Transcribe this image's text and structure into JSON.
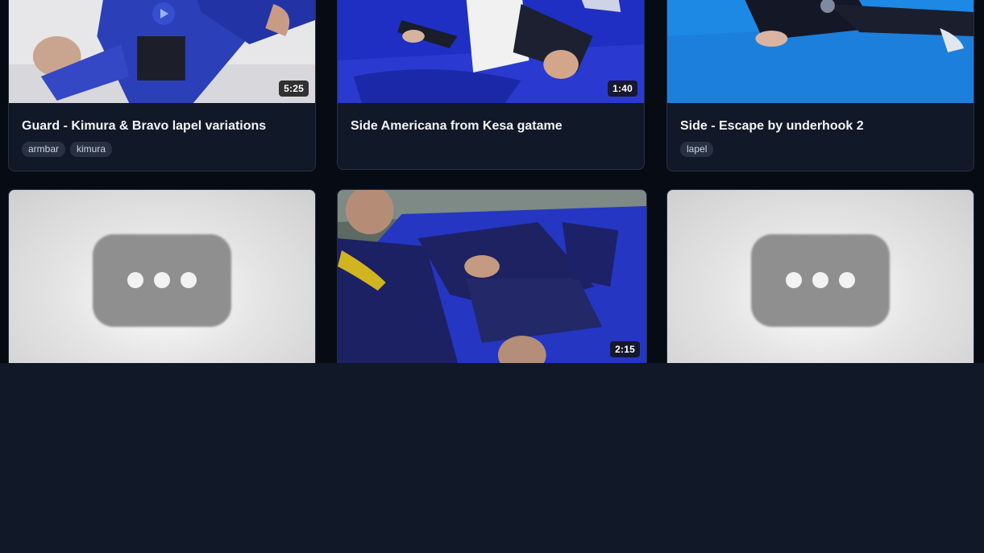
{
  "cards": [
    {
      "title": "Guard - Kimura & Bravo lapel variations",
      "duration": "5:25",
      "tags": [
        "armbar",
        "kimura"
      ]
    },
    {
      "title": "Side Americana from Kesa gatame",
      "duration": "1:40",
      "tags": []
    },
    {
      "title": "Side - Escape by underhook 2",
      "duration": "",
      "tags": [
        "lapel"
      ]
    },
    {
      "title": "",
      "duration": "",
      "tags": [],
      "thumbnail": "video-placeholder"
    },
    {
      "title": "",
      "duration": "2:15",
      "tags": []
    },
    {
      "title": "",
      "duration": "",
      "tags": [],
      "thumbnail": "video-placeholder"
    }
  ],
  "colors": {
    "page_bg": "#111827",
    "card_bg": "#111827",
    "tag_bg": "#273142",
    "mat_blue": "#1f2fc4",
    "mat_light_blue": "#1e88e5"
  }
}
